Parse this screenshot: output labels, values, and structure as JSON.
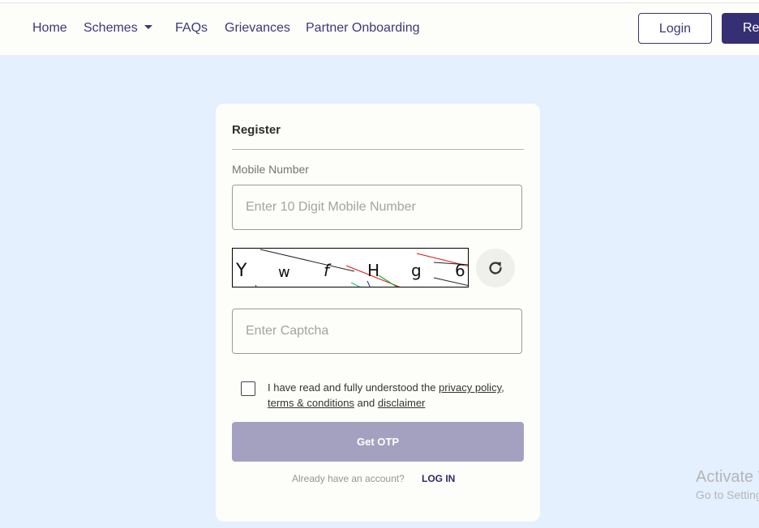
{
  "navbar": {
    "items": [
      {
        "label": "Home"
      },
      {
        "label": "Schemes",
        "has_dropdown": true
      },
      {
        "label": "FAQs"
      },
      {
        "label": "Grievances"
      },
      {
        "label": "Partner Onboarding"
      }
    ],
    "login_label": "Login",
    "register_label": "Register"
  },
  "form": {
    "title": "Register",
    "mobile_label": "Mobile Number",
    "mobile_placeholder": "Enter 10 Digit Mobile Number",
    "mobile_value": "",
    "captcha_text": "YwfHg6",
    "captcha_chars": [
      "Y",
      "w",
      "f",
      "H",
      "g",
      "6"
    ],
    "captcha_placeholder": "Enter Captcha",
    "captcha_value": "",
    "refresh_icon": "refresh-icon",
    "consent_checked": false,
    "consent_prefix": "I have read and fully understood the ",
    "privacy_policy": "privacy policy",
    "comma": ",",
    "terms": "terms & conditions",
    "and_text": " and ",
    "disclaimer": "disclaimer",
    "submit_label": "Get OTP",
    "already_text": "Already have an account?",
    "login_link": "LOG IN"
  },
  "colors": {
    "brand": "#372f73",
    "page_bg": "#e4f0fd",
    "button_disabled": "#a4a0c0"
  },
  "watermark": {
    "line1": "Activate Windows",
    "line2": "Go to Settings to activate Windows."
  }
}
